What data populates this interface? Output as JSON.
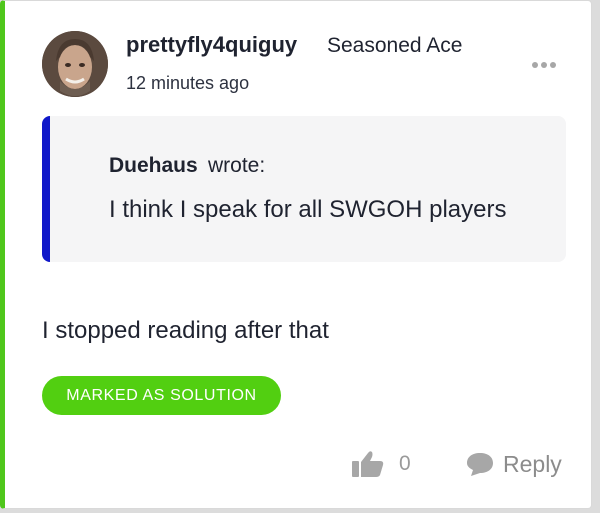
{
  "post": {
    "username": "prettyfly4quiguy",
    "rank": "Seasoned Ace",
    "timestamp": "12 minutes ago",
    "quote": {
      "author": "Duehaus",
      "wrote_label": "wrote:",
      "text": "I think I speak for all SWGOH players"
    },
    "body": "I stopped reading after that",
    "solution_badge": "MARKED AS SOLUTION",
    "like_count": "0",
    "reply_label": "Reply"
  },
  "colors": {
    "accent_green": "#4fc71c",
    "badge_green": "#52cf11",
    "quote_bar": "#1018c9",
    "quote_bg": "#f5f5f6",
    "muted_icon": "#a7a7a7"
  },
  "icons": {
    "more": "more-dots-icon",
    "like": "thumbs-up-icon",
    "reply": "speech-bubble-icon"
  }
}
